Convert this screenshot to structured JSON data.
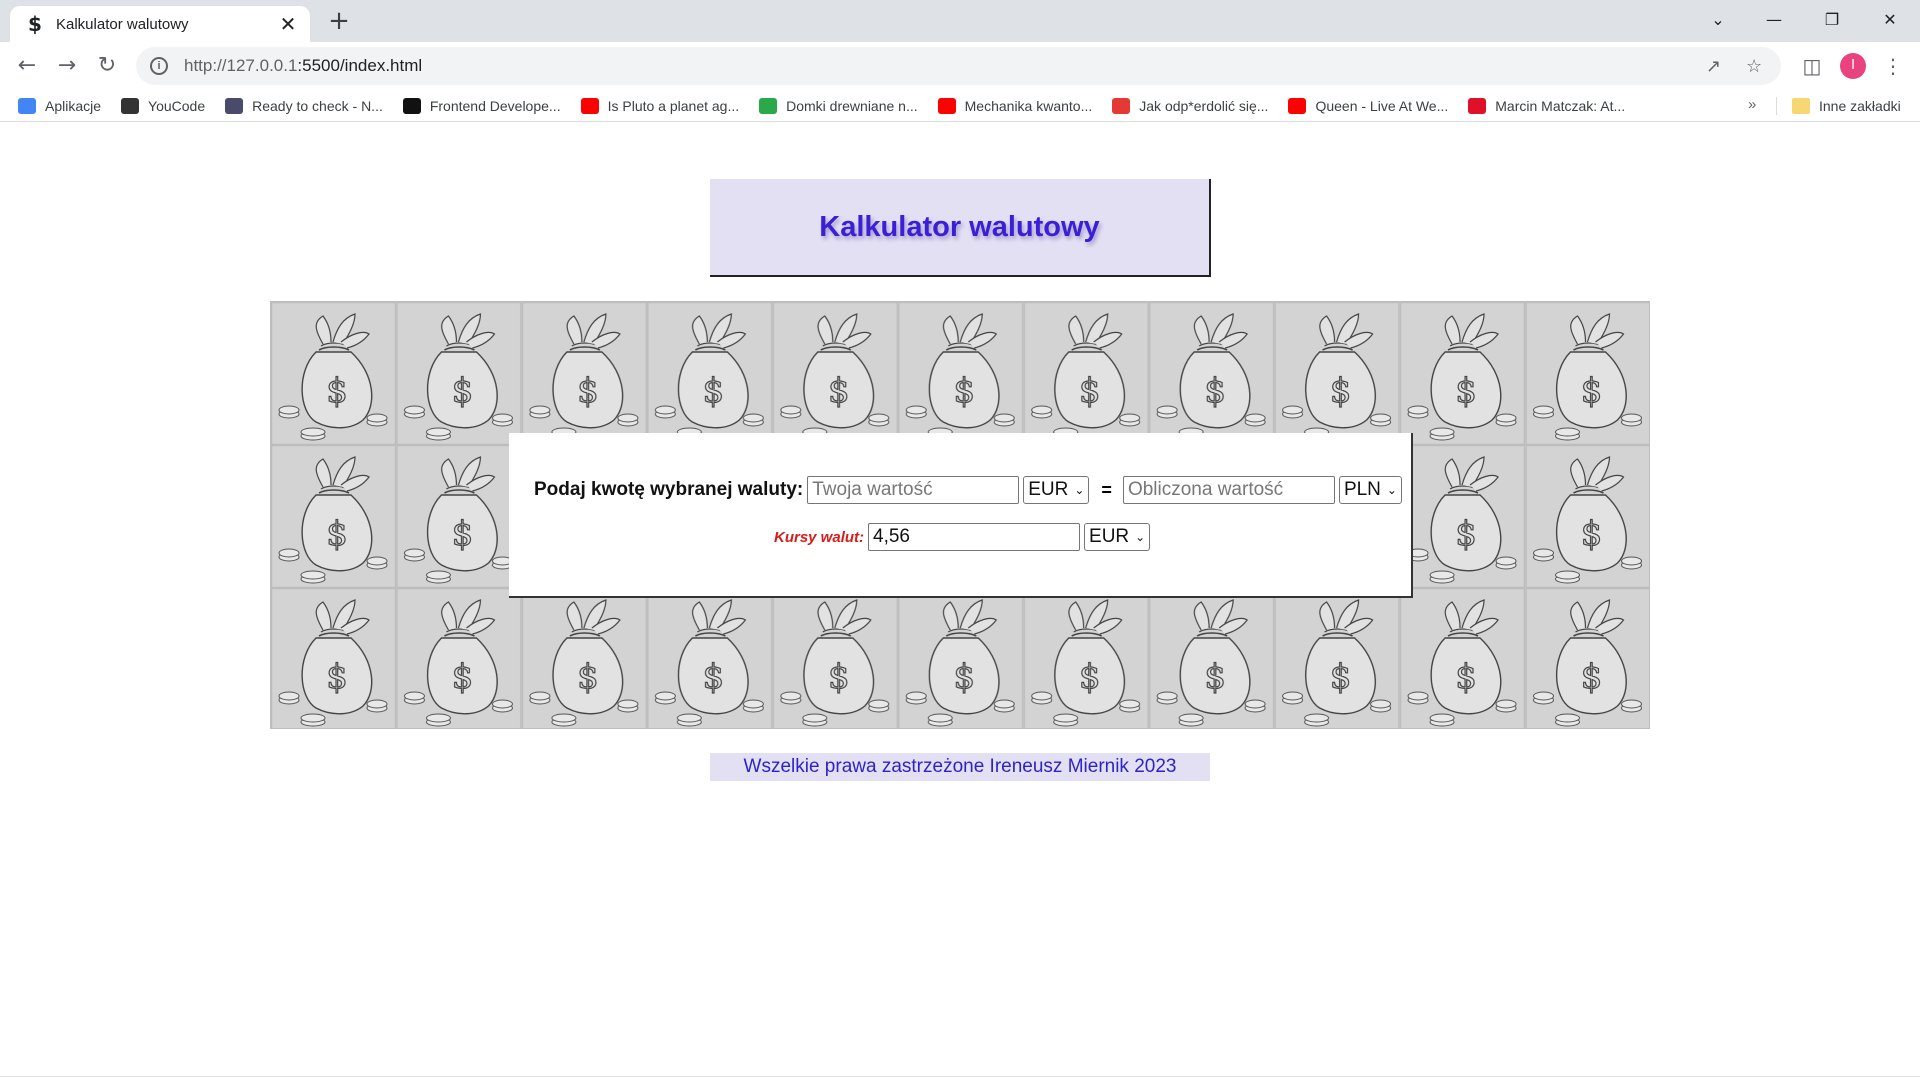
{
  "browser": {
    "tab": {
      "favicon": "$",
      "title": "Kalkulator walutowy",
      "close": "✕"
    },
    "new_tab": "+",
    "window_controls": {
      "tab_search": "⌄",
      "minimize": "—",
      "restore": "❐",
      "close": "✕"
    },
    "url_host": "http://127.0.0.1",
    "url_rest": ":5500/index.html",
    "avatar_letter": "I",
    "bookmarks": [
      {
        "label": "Aplikacje",
        "icon": "apps-grid-icon",
        "color": "#4285f4"
      },
      {
        "label": "YouCode",
        "icon": "youcode-icon",
        "color": "#333333"
      },
      {
        "label": "Ready to check - N...",
        "icon": "wolf-icon",
        "color": "#4a4a6a"
      },
      {
        "label": "Frontend Develope...",
        "icon": "frontend-icon",
        "color": "#111111"
      },
      {
        "label": "Is Pluto a planet ag...",
        "icon": "youtube-icon",
        "color": "#ff0000"
      },
      {
        "label": "Domki drewniane n...",
        "icon": "s-logo-icon",
        "color": "#2aa84a"
      },
      {
        "label": "Mechanika kwanto...",
        "icon": "youtube-icon",
        "color": "#ff0000"
      },
      {
        "label": "Jak odp*erdolić się...",
        "icon": "dots-icon",
        "color": "#e53935"
      },
      {
        "label": "Queen - Live At We...",
        "icon": "youtube-icon",
        "color": "#ff0000"
      },
      {
        "label": "Marcin Matczak: At...",
        "icon": "bookmark-red-icon",
        "color": "#e0102b"
      }
    ],
    "bookmarks_more": "»",
    "other_bookmarks": "Inne zakładki"
  },
  "page": {
    "title": "Kalkulator walutowy",
    "form": {
      "amount_label": "Podaj kwotę wybranej waluty:",
      "amount_placeholder": "Twoja wartość",
      "from_currency": "EUR",
      "equals": "=",
      "result_placeholder": "Obliczona wartość",
      "to_currency": "PLN",
      "rates_label": "Kursy walut:",
      "rate_value": "4,56",
      "rate_currency": "EUR"
    },
    "footer": "Wszelkie prawa zastrzeżone Ireneusz Miernik 2023"
  }
}
